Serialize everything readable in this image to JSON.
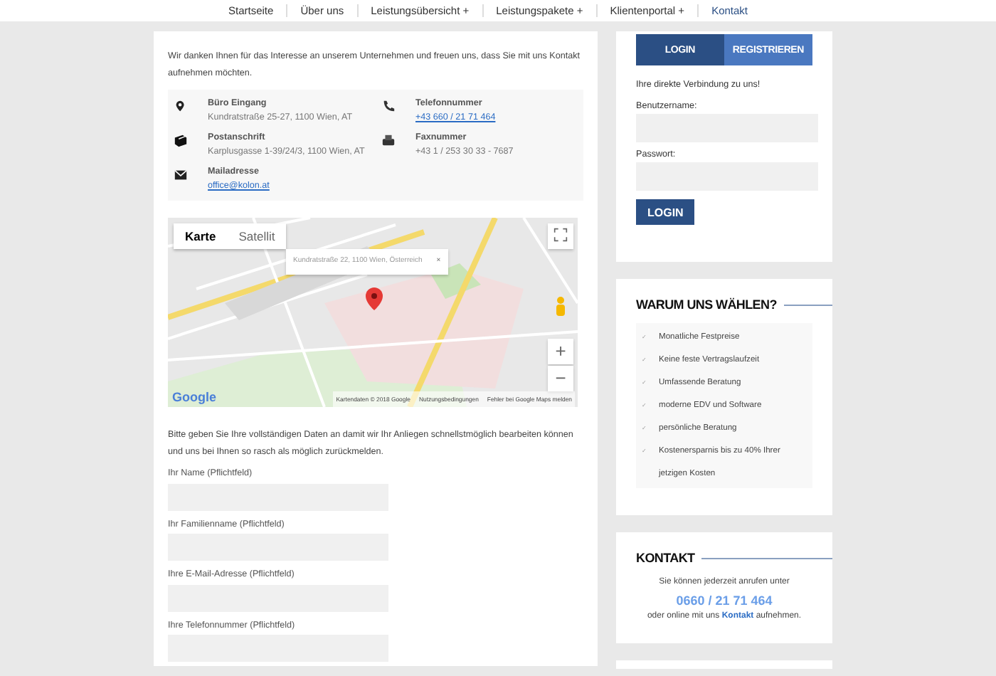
{
  "nav": {
    "items": [
      {
        "label": "Startseite",
        "selected": false
      },
      {
        "label": "Über uns",
        "selected": false
      },
      {
        "label": "Leistungsübersicht",
        "submenu_mark": "+",
        "selected": false
      },
      {
        "label": "Leistungspakete",
        "submenu_mark": "+",
        "selected": false
      },
      {
        "label": "Klientenportal",
        "submenu_mark": "+",
        "selected": false
      },
      {
        "label": "Kontakt",
        "selected": true
      }
    ]
  },
  "intro": "Wir danken Ihnen für das Interesse an unserem Unternehmen und freuen uns, dass Sie mit uns Kontakt aufnehmen möchten.",
  "contact_details": [
    {
      "kind": "location",
      "label": "Büro Eingang",
      "value": "Kundratstraße 25-27, 1100 Wien, AT",
      "link": false
    },
    {
      "kind": "phone",
      "label": "Telefonnummer",
      "value": "+43 660 / 21 71 464",
      "link": true
    },
    {
      "kind": "mail-package",
      "label": "Postanschrift",
      "value": "Karplusgasse 1-39/24/3, 1100 Wien, AT",
      "link": false
    },
    {
      "kind": "fax",
      "label": "Faxnummer",
      "value": "+43 1 / 253 30 33 - 7687",
      "link": false
    },
    {
      "kind": "email",
      "label": "Mailadresse",
      "value": "office@kolon.at",
      "link": true
    }
  ],
  "map": {
    "map_types": [
      {
        "label": "Karte",
        "selected": true
      },
      {
        "label": "Satellit",
        "selected": false
      }
    ],
    "info_window": "Kundratstraße 22, 1100 Wien, Österreich",
    "close": "×",
    "zoom_in": "+",
    "zoom_out": "−",
    "logo": "Google",
    "attribution": [
      "Kartendaten © 2018 Google",
      "Nutzungsbedingungen",
      "Fehler bei Google Maps melden"
    ]
  },
  "form": {
    "intro": "Bitte geben Sie Ihre vollständigen Daten an damit wir Ihr Anliegen schnellstmöglich bearbeiten können und uns bei Ihnen so rasch als möglich zurückmelden.",
    "fields": [
      {
        "label": "Ihr Name (Pflichtfeld)"
      },
      {
        "label": "Ihr Familienname (Pflichtfeld)"
      },
      {
        "label": "Ihre E-Mail-Adresse (Pflichtfeld)"
      },
      {
        "label": "Ihre Telefonnummer (Pflichtfeld)"
      }
    ]
  },
  "login": {
    "tabs": [
      {
        "label": "LOGIN",
        "selected": true
      },
      {
        "label": "REGISTRIEREN",
        "selected": false
      }
    ],
    "text": "Ihre direkte Verbindung zu uns!",
    "fields": [
      {
        "label": "Benutzername:"
      },
      {
        "label": "Passwort:"
      }
    ],
    "button": "LOGIN"
  },
  "why": {
    "title": "WARUM UNS WÄHLEN?",
    "bullet": "✓",
    "items": [
      "Monatliche Festpreise",
      "Keine feste Vertragslaufzeit",
      "Umfassende Beratung",
      "moderne EDV und Software",
      "persönliche Beratung",
      "Kostenersparnis bis zu 40% Ihrer jetzigen Kosten"
    ]
  },
  "contact": {
    "title": "KONTAKT",
    "text": "Sie können jederzeit anrufen unter",
    "phone": "0660 / 21 71 464",
    "before": "oder online mit uns",
    "link": "Kontakt",
    "after": "aufnehmen."
  }
}
